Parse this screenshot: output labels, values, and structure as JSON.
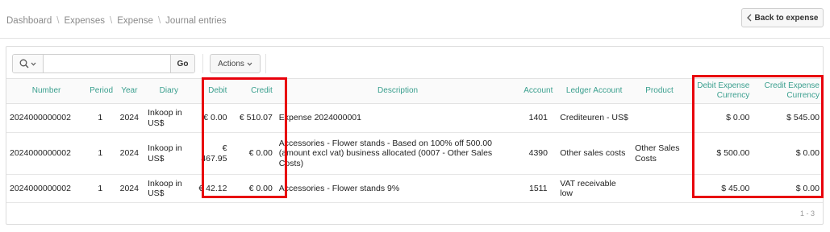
{
  "breadcrumb": [
    {
      "label": "Dashboard"
    },
    {
      "label": "Expenses"
    },
    {
      "label": "Expense"
    },
    {
      "label": "Journal entries"
    }
  ],
  "back_button": {
    "label": "Back to expense"
  },
  "toolbar": {
    "search_placeholder": "",
    "go_label": "Go",
    "actions_label": "Actions"
  },
  "table": {
    "columns": {
      "number": "Number",
      "period": "Period",
      "year": "Year",
      "diary": "Diary",
      "debit": "Debit",
      "credit": "Credit",
      "description": "Description",
      "account": "Account",
      "ledger_account": "Ledger Account",
      "product": "Product",
      "debit_expense_currency": "Debit Expense Currency",
      "credit_expense_currency": "Credit Expense Currency"
    },
    "rows": [
      {
        "number": "2024000000002",
        "period": "1",
        "year": "2024",
        "diary": "Inkoop in US$",
        "debit": "€ 0.00",
        "credit": "€ 510.07",
        "description": "Expense 2024000001",
        "account": "1401",
        "ledger_account": "Crediteuren - US$",
        "product": "",
        "debit_expense_currency": "$ 0.00",
        "credit_expense_currency": "$ 545.00"
      },
      {
        "number": "2024000000002",
        "period": "1",
        "year": "2024",
        "diary": "Inkoop in US$",
        "debit": "€ 467.95",
        "credit": "€ 0.00",
        "description": "Accessories - Flower stands - Based on 100% off 500.00 (amount excl vat) business allocated (0007 - Other Sales Costs)",
        "account": "4390",
        "ledger_account": "Other sales costs",
        "product": "Other Sales Costs",
        "debit_expense_currency": "$ 500.00",
        "credit_expense_currency": "$ 0.00"
      },
      {
        "number": "2024000000002",
        "period": "1",
        "year": "2024",
        "diary": "Inkoop in US$",
        "debit": "€ 42.12",
        "credit": "€ 0.00",
        "description": "Accessories - Flower stands 9%",
        "account": "1511",
        "ledger_account": "VAT receivable low",
        "product": "",
        "debit_expense_currency": "$ 45.00",
        "credit_expense_currency": "$ 0.00"
      }
    ]
  },
  "pagination": {
    "label": "1 - 3"
  },
  "colors": {
    "accent": "#3a9f8e",
    "highlight": "#e8000b"
  }
}
